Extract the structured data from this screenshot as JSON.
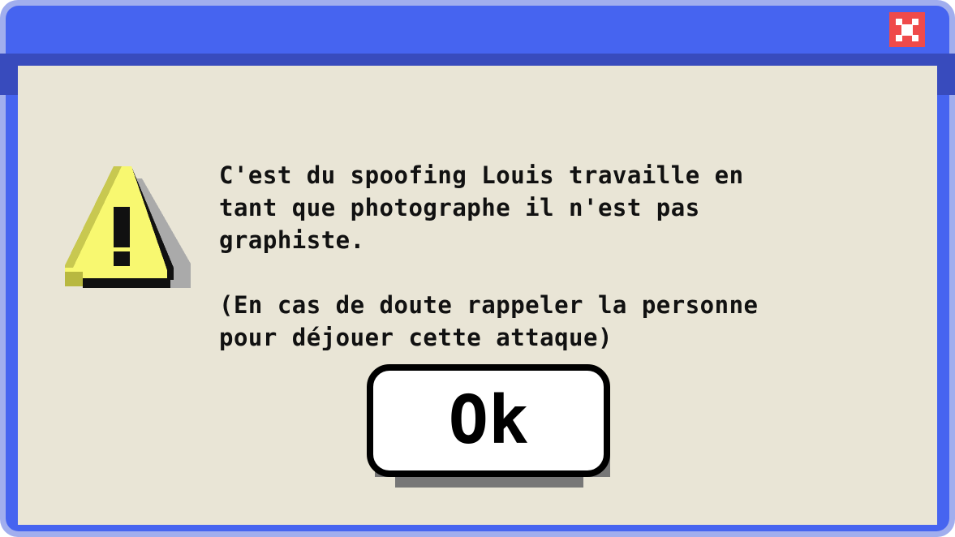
{
  "dialog": {
    "message": "C'est du spoofing Louis travaille en\ntant que photographe il n'est pas\ngraphiste.\n\n(En cas de doute rappeler la personne\npour déjouer cette attaque)",
    "ok_label": "Ok",
    "icon": "warning-icon"
  },
  "titlebar": {
    "close_icon": "close-icon"
  },
  "colors": {
    "title": "#4664f0",
    "panel": "#e9e5d6",
    "close": "#ef4a4a",
    "warning": "#f8f870"
  }
}
